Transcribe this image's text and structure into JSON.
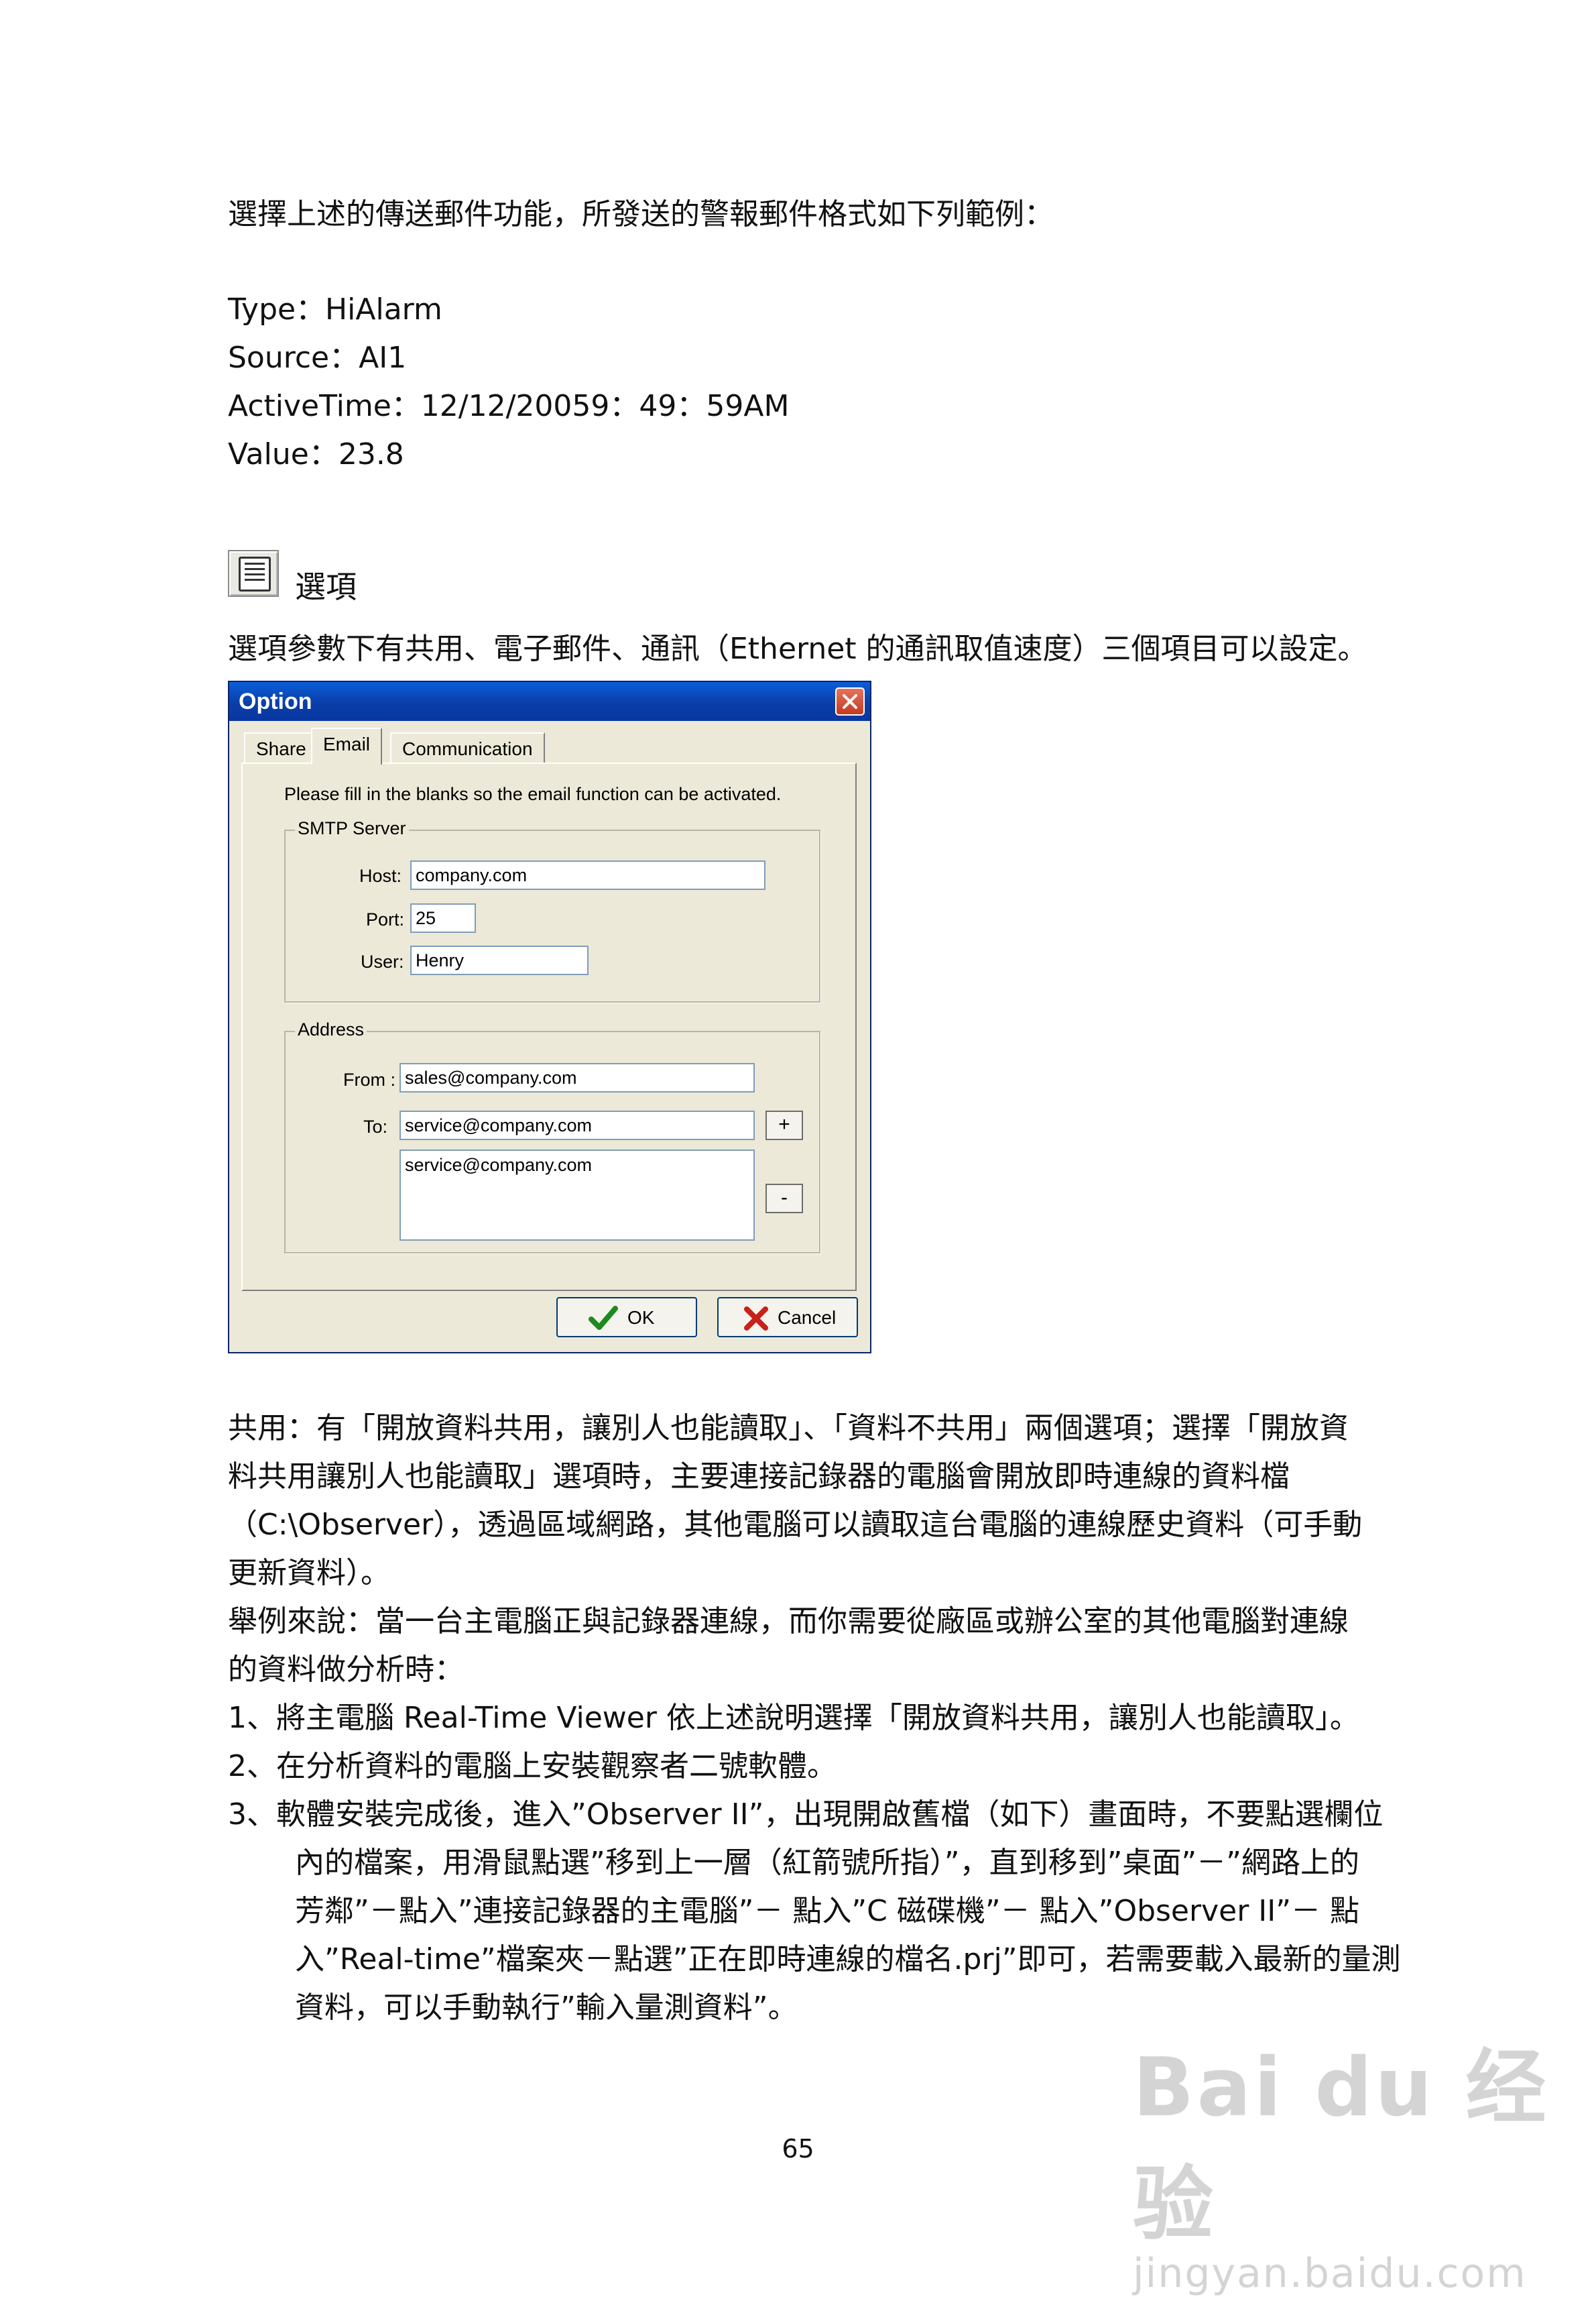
{
  "intro": "選擇上述的傳送郵件功能，所發送的警報郵件格式如下列範例：",
  "alarm": {
    "type": "Type：HiAlarm",
    "source": "Source：AI1",
    "active_time": "ActiveTime：12/12/20059：49：59AM",
    "value": "Value：23.8"
  },
  "section": {
    "icon": "options-notepad-icon",
    "title": "選項",
    "description": "選項參數下有共用、電子郵件、通訊（Ethernet 的通訊取值速度）三個項目可以設定。"
  },
  "dialog": {
    "title": "Option",
    "tabs": [
      "Share",
      "Email",
      "Communication"
    ],
    "active_tab": "Email",
    "hint": "Please fill in the blanks so the email function can be activated.",
    "smtp_group": "SMTP Server",
    "host_label": "Host:",
    "host_value": "company.com",
    "port_label": "Port:",
    "port_value": "25",
    "user_label": "User:",
    "user_value": "Henry",
    "address_group": "Address",
    "from_label": "From :",
    "from_value": "sales@company.com",
    "to_label": "To:",
    "to_value": "service@company.com",
    "to_list": [
      "service@company.com"
    ],
    "add_label": "+",
    "remove_label": "-",
    "ok_label": "OK",
    "cancel_label": "Cancel",
    "colors": {
      "titlebar": "#0a4fc8",
      "face": "#ece9d8",
      "ok_check": "#1d8a1d",
      "cancel_x": "#c8201a"
    }
  },
  "body_lines": [
    "共用：有「開放資料共用，讓別人也能讀取」、「資料不共用」兩個選項；選擇「開放資",
    "料共用讓別人也能讀取」選項時，主要連接記錄器的電腦會開放即時連線的資料檔",
    "（C:\\Observer），透過區域網路，其他電腦可以讀取這台電腦的連線歷史資料（可手動",
    "更新資料）。",
    "舉例來說：當一台主電腦正與記錄器連線，而你需要從廠區或辦公室的其他電腦對連線",
    "的資料做分析時："
  ],
  "steps": [
    "1、將主電腦 Real-Time Viewer  依上述說明選擇「開放資料共用，讓別人也能讀取」。",
    "2、在分析資料的電腦上安裝觀察者二號軟體。",
    "3、軟體安裝完成後，進入”Observer II”，出現開啟舊檔（如下）畫面時，不要點選欄位",
    "內的檔案，用滑鼠點選”移到上一層（紅箭號所指）”，直到移到”桌面”－”網路上的",
    "芳鄰”－點入”連接記錄器的主電腦”－  點入”C 磁碟機”－  點入”Observer II”－  點",
    "入”Real-time”檔案夾－點選”正在即時連線的檔名.prj”即可，若需要載入最新的量測",
    "資料，可以手動執行”輸入量測資料”。"
  ],
  "page_number": "65",
  "watermark": {
    "logo": "Bai du 经验",
    "url": "jingyan.baidu.com"
  }
}
